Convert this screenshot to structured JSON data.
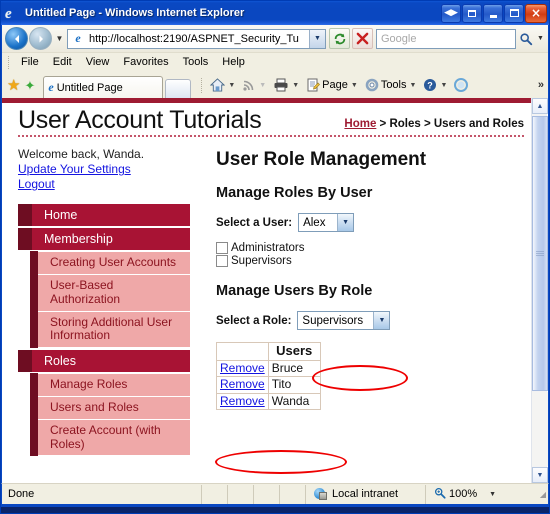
{
  "window": {
    "title": "Untitled Page - Windows Internet Explorer",
    "ie_logo": "e",
    "buttons": {
      "restore_down_left": "restore-left-icon",
      "restore_tab": "restore-tab-icon",
      "minimize": "minimize-icon",
      "maximize": "maximize-icon",
      "close": "×"
    }
  },
  "address_bar": {
    "back": "back-arrow-icon",
    "forward": "forward-arrow-icon",
    "history_caret": "▼",
    "url": "http://localhost:2190/ASPNET_Security_Tu",
    "url_dropdown": "▼",
    "refresh": "refresh-icon",
    "stop": "stop-icon",
    "search_placeholder": "Google",
    "search_go": "search-icon",
    "search_caret": "▼"
  },
  "menu_bar": {
    "items": [
      {
        "label": "File"
      },
      {
        "label": "Edit"
      },
      {
        "label": "View"
      },
      {
        "label": "Favorites"
      },
      {
        "label": "Tools"
      },
      {
        "label": "Help"
      }
    ]
  },
  "tab_bar": {
    "favorites_star": "★",
    "add_favorite": "✦",
    "tab_label": "Untitled Page",
    "new_tab": "new-tab-button"
  },
  "command_bar": {
    "items": [
      {
        "name": "home",
        "label": "",
        "icon": "home-icon",
        "caret": "▼"
      },
      {
        "name": "feeds",
        "label": "",
        "icon": "rss-icon",
        "caret": "▼"
      },
      {
        "name": "print",
        "label": "",
        "icon": "printer-icon",
        "caret": "▼"
      },
      {
        "name": "page",
        "label": "Page",
        "icon": "page-icon",
        "caret": "▼"
      },
      {
        "name": "tools",
        "label": "Tools",
        "icon": "gear-icon",
        "caret": "▼"
      },
      {
        "name": "help",
        "label": "",
        "icon": "help-icon",
        "caret": "▼"
      },
      {
        "name": "extra",
        "label": "",
        "icon": "circle-icon",
        "caret": ""
      }
    ],
    "overflow": "»"
  },
  "page": {
    "site_title": "User Account Tutorials",
    "breadcrumb": {
      "home": "Home",
      "trail": " > Roles > Users and Roles"
    },
    "sidebar": {
      "welcome": "Welcome back, Wanda.",
      "links": [
        {
          "label": "Update Your Settings"
        },
        {
          "label": "Logout"
        }
      ],
      "nav": [
        {
          "label": "Home",
          "type": "top"
        },
        {
          "label": "Membership",
          "type": "top"
        },
        {
          "label": "Creating User Accounts",
          "type": "sub"
        },
        {
          "label": "User-Based Authorization",
          "type": "sub"
        },
        {
          "label": "Storing Additional User Information",
          "type": "sub"
        },
        {
          "label": "Roles",
          "type": "top"
        },
        {
          "label": "Manage Roles",
          "type": "sub"
        },
        {
          "label": "Users and Roles",
          "type": "sub"
        },
        {
          "label": "Create Account (with Roles)",
          "type": "sub"
        }
      ]
    },
    "content": {
      "title": "User Role Management",
      "manage_roles_by_user": {
        "heading": "Manage Roles By User",
        "select_label": "Select a User:",
        "selected_user": "Alex",
        "dropdown_caret": "▼",
        "roles": [
          {
            "label": "Administrators",
            "checked": false
          },
          {
            "label": "Supervisors",
            "checked": false
          }
        ]
      },
      "manage_users_by_role": {
        "heading": "Manage Users By Role",
        "select_label": "Select a Role:",
        "selected_role": "Supervisors",
        "dropdown_caret": "▼",
        "table": {
          "headers": [
            "",
            "Users"
          ],
          "rows": [
            {
              "action": "Remove",
              "user": "Bruce"
            },
            {
              "action": "Remove",
              "user": "Tito"
            },
            {
              "action": "Remove",
              "user": "Wanda"
            }
          ]
        }
      }
    },
    "annotations": {
      "accent_color": "#ee0000",
      "highlighted": [
        "selected_role_dropdown",
        "remove-wanda-row"
      ]
    }
  },
  "scrollbar": {
    "up_arrow": "▲",
    "down_arrow": "▼"
  },
  "status_bar": {
    "status": "Done",
    "zone": "Local intranet",
    "zoom": "100%",
    "zoom_caret": "▼",
    "zoom_icon": "zoom-icon"
  },
  "colors": {
    "brand_red": "#9e1b32",
    "nav_top_bg": "#a81334",
    "nav_top_stripe": "#6e0d22",
    "nav_sub_bg": "#efa8a8",
    "nav_sub_text": "#8c1420",
    "link_blue": "#1414e0",
    "annotation_red": "#ee0000"
  }
}
